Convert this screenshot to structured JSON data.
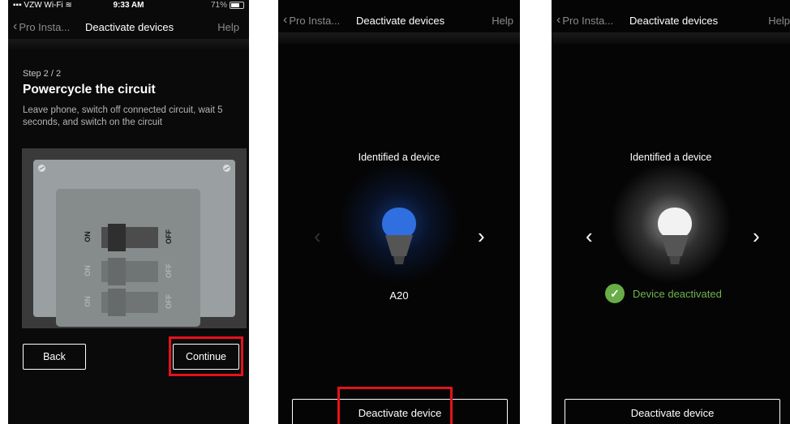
{
  "screens": [
    {
      "status": {
        "carrier": "VZW Wi-Fi",
        "time": "9:33 AM",
        "battery": "71%"
      },
      "nav": {
        "back": "Pro Insta...",
        "title": "Deactivate devices",
        "help": "Help"
      },
      "step": "Step 2 / 2",
      "heading": "Powercycle the circuit",
      "description": "Leave phone, switch off connected circuit, wait 5 seconds, and switch on the circuit",
      "breaker": {
        "on_label": "ON",
        "off_label": "OFF"
      },
      "back_button": "Back",
      "continue_button": "Continue"
    },
    {
      "nav": {
        "back": "Pro Insta...",
        "title": "Deactivate devices",
        "help": "Help"
      },
      "identified": "Identified a device",
      "model": "A20",
      "bulb_color": "#2f6fe0",
      "deactivate_button": "Deactivate device"
    },
    {
      "nav": {
        "back": "Pro Insta...",
        "title": "Deactivate devices",
        "help": "Help"
      },
      "identified": "Identified a device",
      "status_text": "Device deactivated",
      "bulb_color": "#f2f2f2",
      "deactivate_button": "Deactivate device"
    }
  ],
  "colors": {
    "highlight": "#e5121b",
    "success": "#68ad47",
    "background": "#0a0a0a"
  }
}
